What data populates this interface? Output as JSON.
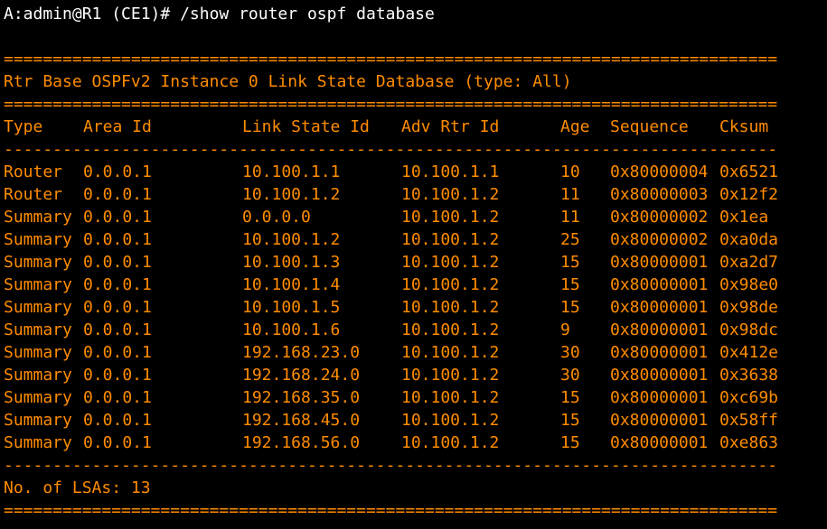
{
  "prompt": "A:admin@R1 (CE1)# /show router ospf database",
  "colors": {
    "background": "#000000",
    "text": "#ffffff",
    "output": "#ff8c00"
  },
  "separator_double": "===============================================================================",
  "separator_single": "-------------------------------------------------------------------------------",
  "title": "Rtr Base OSPFv2 Instance 0 Link State Database (type: All)",
  "columns": [
    "Type",
    "Area Id",
    "Link State Id",
    "Adv Rtr Id",
    "Age",
    "Sequence",
    "Cksum"
  ],
  "rows": [
    [
      "Router",
      "0.0.0.1",
      "10.100.1.1",
      "10.100.1.1",
      "10",
      "0x80000004",
      "0x6521"
    ],
    [
      "Router",
      "0.0.0.1",
      "10.100.1.2",
      "10.100.1.2",
      "11",
      "0x80000003",
      "0x12f2"
    ],
    [
      "Summary",
      "0.0.0.1",
      "0.0.0.0",
      "10.100.1.2",
      "11",
      "0x80000002",
      "0x1ea"
    ],
    [
      "Summary",
      "0.0.0.1",
      "10.100.1.2",
      "10.100.1.2",
      "25",
      "0x80000002",
      "0xa0da"
    ],
    [
      "Summary",
      "0.0.0.1",
      "10.100.1.3",
      "10.100.1.2",
      "15",
      "0x80000001",
      "0xa2d7"
    ],
    [
      "Summary",
      "0.0.0.1",
      "10.100.1.4",
      "10.100.1.2",
      "15",
      "0x80000001",
      "0x98e0"
    ],
    [
      "Summary",
      "0.0.0.1",
      "10.100.1.5",
      "10.100.1.2",
      "15",
      "0x80000001",
      "0x98de"
    ],
    [
      "Summary",
      "0.0.0.1",
      "10.100.1.6",
      "10.100.1.2",
      "9",
      "0x80000001",
      "0x98dc"
    ],
    [
      "Summary",
      "0.0.0.1",
      "192.168.23.0",
      "10.100.1.2",
      "30",
      "0x80000001",
      "0x412e"
    ],
    [
      "Summary",
      "0.0.0.1",
      "192.168.24.0",
      "10.100.1.2",
      "30",
      "0x80000001",
      "0x3638"
    ],
    [
      "Summary",
      "0.0.0.1",
      "192.168.35.0",
      "10.100.1.2",
      "15",
      "0x80000001",
      "0xc69b"
    ],
    [
      "Summary",
      "0.0.0.1",
      "192.168.45.0",
      "10.100.1.2",
      "15",
      "0x80000001",
      "0x58ff"
    ],
    [
      "Summary",
      "0.0.0.1",
      "192.168.56.0",
      "10.100.1.2",
      "15",
      "0x80000001",
      "0xe863"
    ]
  ],
  "footer": "No. of LSAs: 13"
}
